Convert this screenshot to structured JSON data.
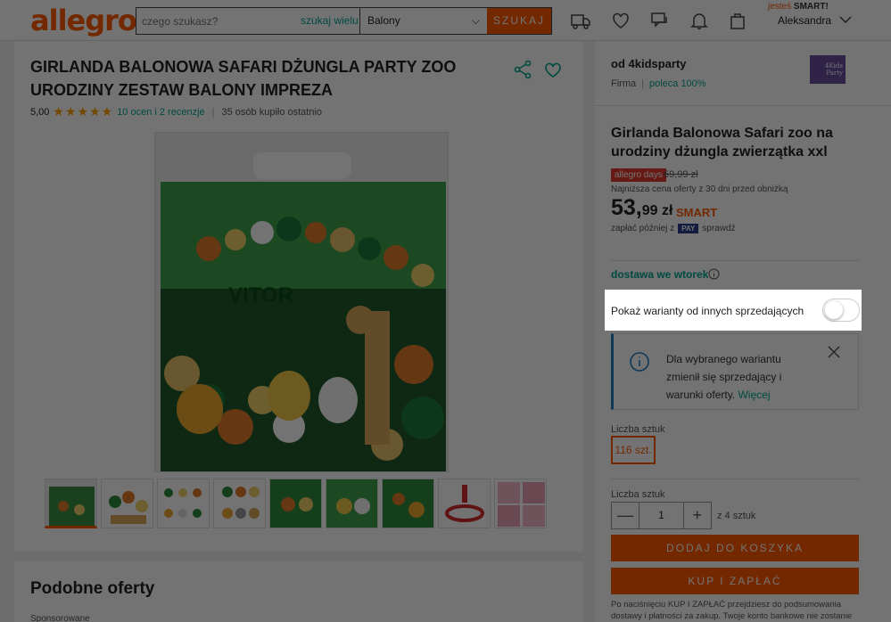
{
  "header": {
    "logo": "allegro",
    "search_placeholder": "czego szukasz?",
    "search_many": "szukaj wielu",
    "category": "Balony",
    "search_button": "SZUKAJ",
    "smart_prefix": "jesteś",
    "smart_label": "SMART!",
    "user_name": "Aleksandra"
  },
  "product": {
    "title": "GIRLANDA BALONOWA SAFARI DŻUNGLA PARTY ZOO URODZINY ZESTAW BALONY IMPREZA",
    "rating_value": "5,00",
    "stars": "★★★★★",
    "reviews": "10 ocen i 2 recenzje",
    "bought": "35 osób kupiło ostatnio",
    "image_text": "VITOR"
  },
  "similar": {
    "title": "Podobne oferty",
    "sponsored": "Sponsorowane"
  },
  "seller": {
    "name": "od 4kidsparty",
    "type": "Firma",
    "recommend": "poleca 100%",
    "logo_text": "4Kids Party"
  },
  "offer": {
    "title": "Girlanda Balonowa Safari zoo na urodziny dżungla zwierzątka xxl",
    "badge": "allegro days",
    "old_price": "59,99 zł",
    "lowest_price_note": "Najniższa cena oferty z 30 dni przed obniżką",
    "price_main": "53,",
    "price_cents": "99 zł",
    "smart_logo": "SMART",
    "pay_later_prefix": "zapłać później z",
    "pay_label": "PAY",
    "pay_later_suffix": "sprawdź",
    "delivery": "dostawa we wtorek",
    "toggle_label": "Pokaż warianty od innych sprzedających",
    "info_text": "Dla wybranego wariantu zmienił się sprzedający i warunki oferty.",
    "info_more": "Więcej",
    "qty_label_1": "Liczba sztuk",
    "variant": "116 szt.",
    "qty_label_2": "Liczba sztuk",
    "qty_minus": "—",
    "qty_value": "1",
    "qty_plus": "+",
    "of_pieces": "z 4 sztuk",
    "add_to_cart": "DODAJ DO KOSZYKA",
    "buy_now": "KUP I ZAPŁAĆ",
    "legal": "Po naciśnięciu KUP I ZAPŁAĆ przejdziesz do podsumowania dostawy i płatności za zakup. Twoje konto bankowe nie zostanie"
  },
  "colors": {
    "brand": "#ff5a00",
    "link": "#00a790",
    "info": "#1e7fc2"
  }
}
